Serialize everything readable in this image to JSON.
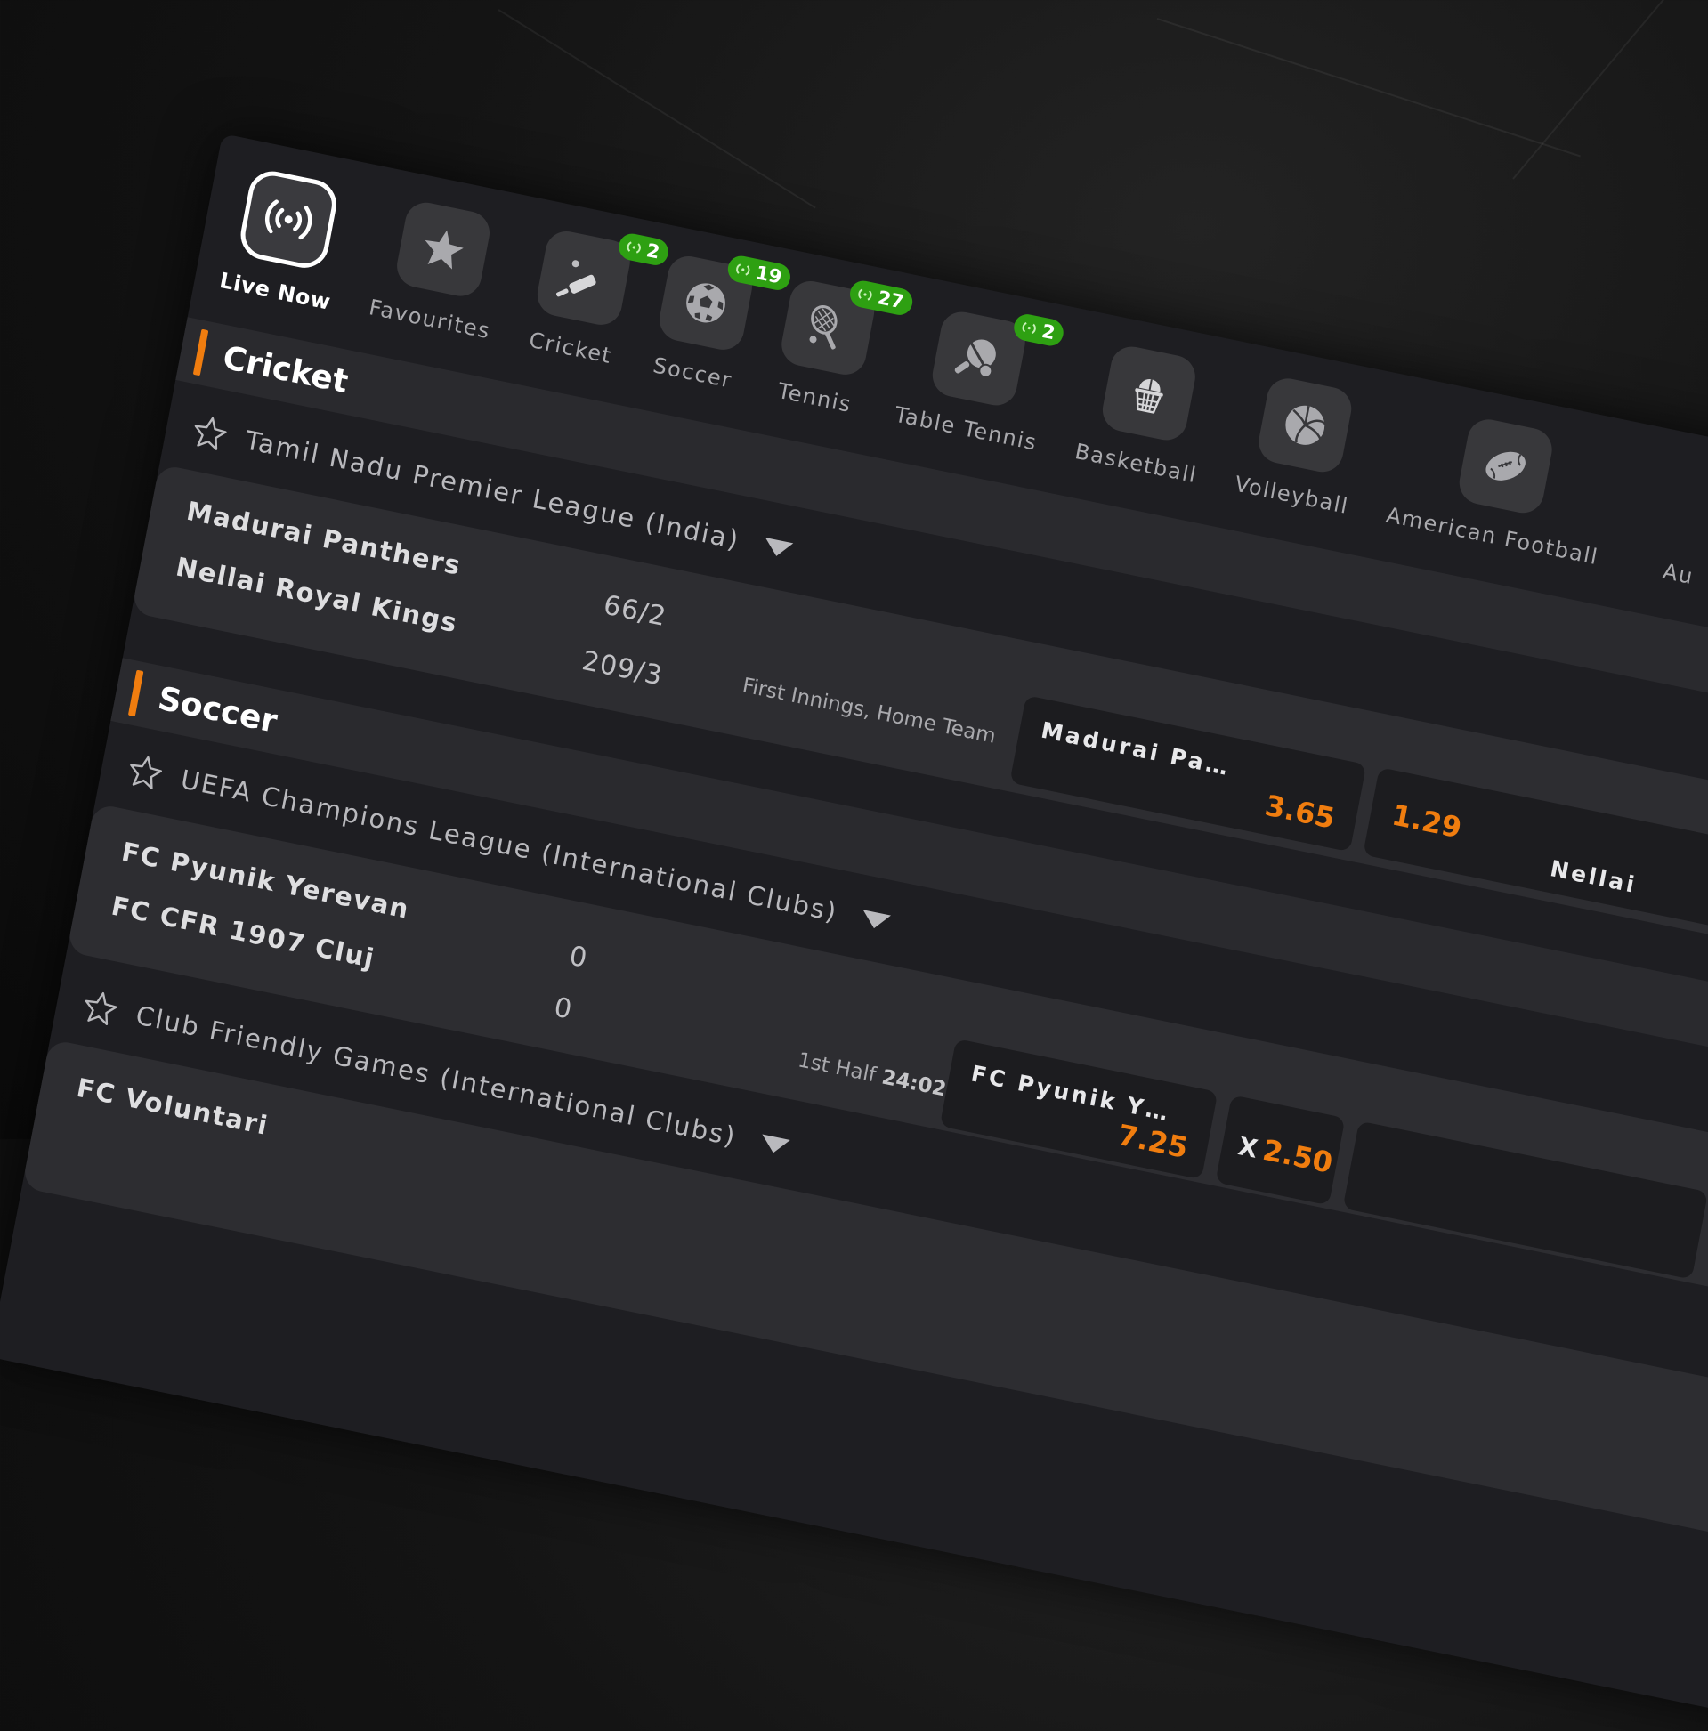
{
  "tabs": [
    {
      "key": "live-now",
      "label": "Live Now",
      "icon": "live-broadcast-icon",
      "active": true,
      "live_count": null
    },
    {
      "key": "favourites",
      "label": "Favourites",
      "icon": "star-icon",
      "active": false,
      "live_count": null
    },
    {
      "key": "cricket",
      "label": "Cricket",
      "icon": "cricket-bat-icon",
      "active": false,
      "live_count": "2"
    },
    {
      "key": "soccer",
      "label": "Soccer",
      "icon": "soccer-ball-icon",
      "active": false,
      "live_count": "19"
    },
    {
      "key": "tennis",
      "label": "Tennis",
      "icon": "tennis-racket-icon",
      "active": false,
      "live_count": "27"
    },
    {
      "key": "table-tennis",
      "label": "Table Tennis",
      "icon": "ping-pong-paddle-icon",
      "active": false,
      "live_count": "2"
    },
    {
      "key": "basketball",
      "label": "Basketball",
      "icon": "basketball-hoop-icon",
      "active": false,
      "live_count": null
    },
    {
      "key": "volleyball",
      "label": "Volleyball",
      "icon": "volleyball-icon",
      "active": false,
      "live_count": null
    },
    {
      "key": "american-football",
      "label": "American Football",
      "icon": "american-football-icon",
      "active": false,
      "live_count": null
    },
    {
      "key": "australian-rules",
      "label": "Au",
      "icon": null,
      "active": false,
      "live_count": null
    }
  ],
  "sections": {
    "cricket": {
      "title": "Cricket",
      "league": "Tamil Nadu Premier League (India)",
      "match": {
        "home": "Madurai Panthers",
        "away": "Nellai Royal Kings",
        "home_score": "66/2",
        "away_score": "209/3",
        "status": "First Innings, Home Team",
        "odds": [
          {
            "label": "Madurai Pa…",
            "value": "3.65"
          },
          {
            "label": "Nellai",
            "value": "1.29"
          }
        ]
      }
    },
    "soccer": {
      "title": "Soccer",
      "league": "UEFA Champions League (International Clubs)",
      "match": {
        "home": "FC Pyunik Yerevan",
        "away": "FC CFR 1907 Cluj",
        "home_score": "0",
        "away_score": "0",
        "status_period": "1st Half",
        "status_clock": "24:02",
        "odds": [
          {
            "label": "FC Pyunik Y…",
            "value": "7.25"
          },
          {
            "label": "X",
            "value": "2.50"
          }
        ]
      },
      "league2": "Club Friendly Games (International Clubs)",
      "match2": {
        "home": "FC Voluntari"
      }
    }
  },
  "colors": {
    "accent": "#f07d0f",
    "live_badge": "#2ea012",
    "panel": "#1e1e22"
  }
}
